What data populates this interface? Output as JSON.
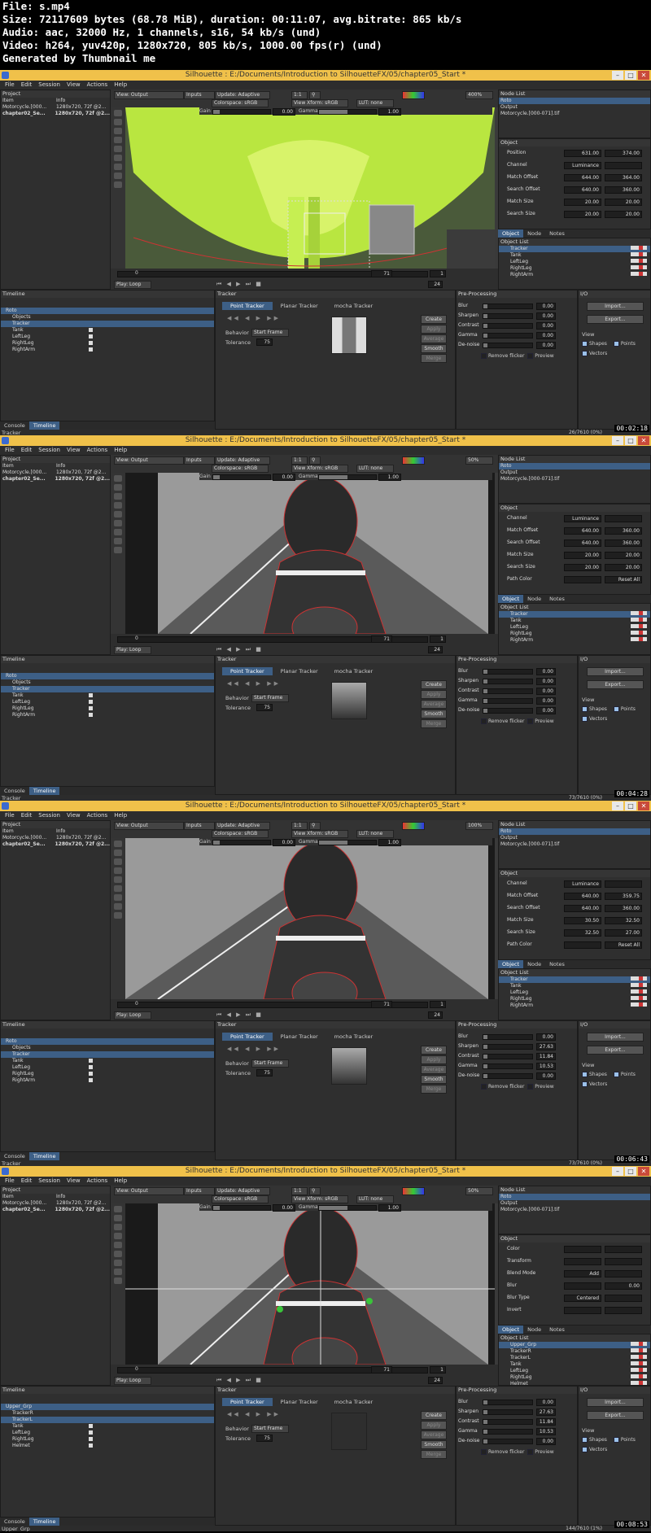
{
  "header": {
    "lines": [
      "File: s.mp4",
      "Size: 72117609 bytes (68.78 MiB), duration: 00:11:07, avg.bitrate: 865 kb/s",
      "Audio: aac, 32000 Hz, 1 channels, s16, 54 kb/s (und)",
      "Video: h264, yuv420p, 1280x720, 805 kb/s, 1000.00 fps(r) (und)",
      "Generated by Thumbnail me"
    ]
  },
  "menu": [
    "File",
    "Edit",
    "Session",
    "View",
    "Actions",
    "Help"
  ],
  "panels": {
    "project": "Project",
    "item": "Item",
    "info": "Info",
    "rows": [
      {
        "item": "Motorcycle.[000...",
        "info": "1280x720, 72f @2..."
      },
      {
        "item": "chapter02_Se...",
        "info": "1280x720, 72f @2..."
      }
    ],
    "node_list": "Node List",
    "object": "Object",
    "object_list": "Object List",
    "timeline": "Timeline",
    "tracker": "Tracker",
    "preprocessing": "Pre-Processing",
    "io": "I/O",
    "view": "View"
  },
  "toolbar": {
    "view": "View: Output",
    "inputs": "Inputs",
    "update": "Update: Adaptive",
    "ratio": "1:1",
    "colorspace": "Colorspace: sRGB",
    "xform": "View Xform: sRGB",
    "lut": "LUT: none",
    "gain": "Gain",
    "gamma": "Gamma",
    "gain_val": "0.00",
    "gamma_val": "1.00",
    "loop": "Play: Loop",
    "fps": "24"
  },
  "tabs": [
    "Object",
    "Node",
    "Notes"
  ],
  "tracker_tabs": [
    "Point Tracker",
    "Planar Tracker",
    "mocha Tracker"
  ],
  "tracker": {
    "behavior": "Behavior",
    "behavior_val": "Start Frame",
    "tolerance": "Tolerance",
    "tolerance_val": "75",
    "buttons": [
      "Create",
      "Apply",
      "Average",
      "Smooth",
      "Merge"
    ]
  },
  "prep": {
    "labels": [
      "Blur",
      "Sharpen",
      "Contrast",
      "Gamma",
      "De-noise"
    ],
    "remove_flicker": "Remove flicker",
    "preview": "Preview"
  },
  "io": {
    "import": "Import...",
    "export": "Export...",
    "shapes": "Shapes",
    "points": "Points",
    "vectors": "Vectors"
  },
  "bottom_tabs": [
    "Console",
    "Timeline"
  ],
  "shots": [
    {
      "title": "Silhouette : E:/Documents/Introduction to SilhouetteFX/05/chapter05_Start *",
      "zoom": "400%",
      "frame_start": "0",
      "frame_cur": "71",
      "frame_end": "1",
      "nodes": [
        "Roto",
        "Output",
        "Motorcycle.[000-071].tif"
      ],
      "object_rows": [
        {
          "label": "Position",
          "a": "631.00",
          "b": "374.00"
        },
        {
          "label": "Channel",
          "a": "Luminance",
          "b": ""
        },
        {
          "label": "Match Offset",
          "a": "644.00",
          "b": "364.00"
        },
        {
          "label": "Search Offset",
          "a": "640.00",
          "b": "360.00"
        },
        {
          "label": "Match Size",
          "a": "20.00",
          "b": "20.00"
        },
        {
          "label": "Search Size",
          "a": "20.00",
          "b": "20.00"
        }
      ],
      "objlist": [
        "Tracker",
        "Tank",
        "LeftLeg",
        "RightLeg",
        "RightArm"
      ],
      "timeline_rows": [
        "Roto",
        "Objects",
        "Tracker",
        "Tank",
        "LeftLeg",
        "RightLeg",
        "RightArm"
      ],
      "prep_vals": [
        "0.00",
        "0.00",
        "0.00",
        "0.00",
        "0.00"
      ],
      "status_left": "Tracker",
      "status_right": "26/7610 (0%)",
      "timestamp": "00:02:18"
    },
    {
      "title": "Silhouette : E:/Documents/Introduction to SilhouetteFX/05/chapter05_Start *",
      "zoom": "50%",
      "frame_start": "0",
      "frame_cur": "71",
      "frame_end": "1",
      "nodes": [
        "Roto",
        "Output",
        "Motorcycle.[000-071].tif"
      ],
      "object_rows": [
        {
          "label": "Channel",
          "a": "Luminance",
          "b": ""
        },
        {
          "label": "Match Offset",
          "a": "640.00",
          "b": "360.00"
        },
        {
          "label": "Search Offset",
          "a": "640.00",
          "b": "360.00"
        },
        {
          "label": "Match Size",
          "a": "20.00",
          "b": "20.00"
        },
        {
          "label": "Search Size",
          "a": "20.00",
          "b": "20.00"
        },
        {
          "label": "Path Color",
          "a": "",
          "b": "Reset All"
        }
      ],
      "objlist": [
        "Tracker",
        "Tank",
        "LeftLeg",
        "RightLeg",
        "RightArm"
      ],
      "timeline_rows": [
        "Roto",
        "Objects",
        "Tracker",
        "Tank",
        "LeftLeg",
        "RightLeg",
        "RightArm"
      ],
      "prep_vals": [
        "0.00",
        "0.00",
        "0.00",
        "0.00",
        "0.00"
      ],
      "status_left": "Tracker",
      "status_right": "73/7610 (0%)",
      "timestamp": "00:04:28"
    },
    {
      "title": "Silhouette : E:/Documents/Introduction to SilhouetteFX/05/chapter05_Start *",
      "zoom": "100%",
      "frame_start": "0",
      "frame_cur": "71",
      "frame_end": "1",
      "nodes": [
        "Roto",
        "Output",
        "Motorcycle.[000-071].tif"
      ],
      "object_rows": [
        {
          "label": "Channel",
          "a": "Luminance",
          "b": ""
        },
        {
          "label": "Match Offset",
          "a": "640.00",
          "b": "359.75"
        },
        {
          "label": "Search Offset",
          "a": "640.00",
          "b": "360.00"
        },
        {
          "label": "Match Size",
          "a": "30.50",
          "b": "32.50"
        },
        {
          "label": "Search Size",
          "a": "32.50",
          "b": "27.00"
        },
        {
          "label": "Path Color",
          "a": "",
          "b": "Reset All"
        }
      ],
      "objlist": [
        "Tracker",
        "Tank",
        "LeftLeg",
        "RightLeg",
        "RightArm"
      ],
      "timeline_rows": [
        "Roto",
        "Objects",
        "Tracker",
        "Tank",
        "LeftLeg",
        "RightLeg",
        "RightArm"
      ],
      "prep_vals": [
        "0.00",
        "27.63",
        "11.84",
        "10.53",
        "0.00"
      ],
      "status_left": "Tracker",
      "status_right": "73/7610 (0%)",
      "timestamp": "00:06:43"
    },
    {
      "title": "Silhouette : E:/Documents/Introduction to SilhouetteFX/05/chapter05_Start *",
      "zoom": "50%",
      "frame_start": "0",
      "frame_cur": "71",
      "frame_end": "1",
      "nodes": [
        "Roto",
        "Output",
        "Motorcycle.[000-071].tif"
      ],
      "object_rows": [
        {
          "label": "Color",
          "a": "",
          "b": ""
        },
        {
          "label": "Transform",
          "a": "",
          "b": ""
        },
        {
          "label": "Blend Mode",
          "a": "Add",
          "b": ""
        },
        {
          "label": "Blur",
          "a": "",
          "b": "0.00"
        },
        {
          "label": "Blur Type",
          "a": "Centered",
          "b": ""
        },
        {
          "label": "Invert",
          "a": "",
          "b": ""
        }
      ],
      "objlist": [
        "Upper_Grp",
        "TrackerR",
        "TrackerL",
        "Tank",
        "LeftLeg",
        "RightLeg",
        "Helmet"
      ],
      "timeline_rows": [
        "Upper_Grp",
        "TrackerR",
        "TrackerL",
        "Tank",
        "LeftLeg",
        "RightLeg",
        "Helmet"
      ],
      "prep_vals": [
        "0.00",
        "27.63",
        "11.84",
        "10.53",
        "0.00"
      ],
      "status_left": "Upper_Grp",
      "status_right": "144/7610 (1%)",
      "timestamp": "00:08:53"
    }
  ],
  "colors": {
    "titlebar": "#f0c14a",
    "select": "#3d5f86",
    "panel": "#2f2f2f",
    "trackpath": "#3ac43a"
  }
}
